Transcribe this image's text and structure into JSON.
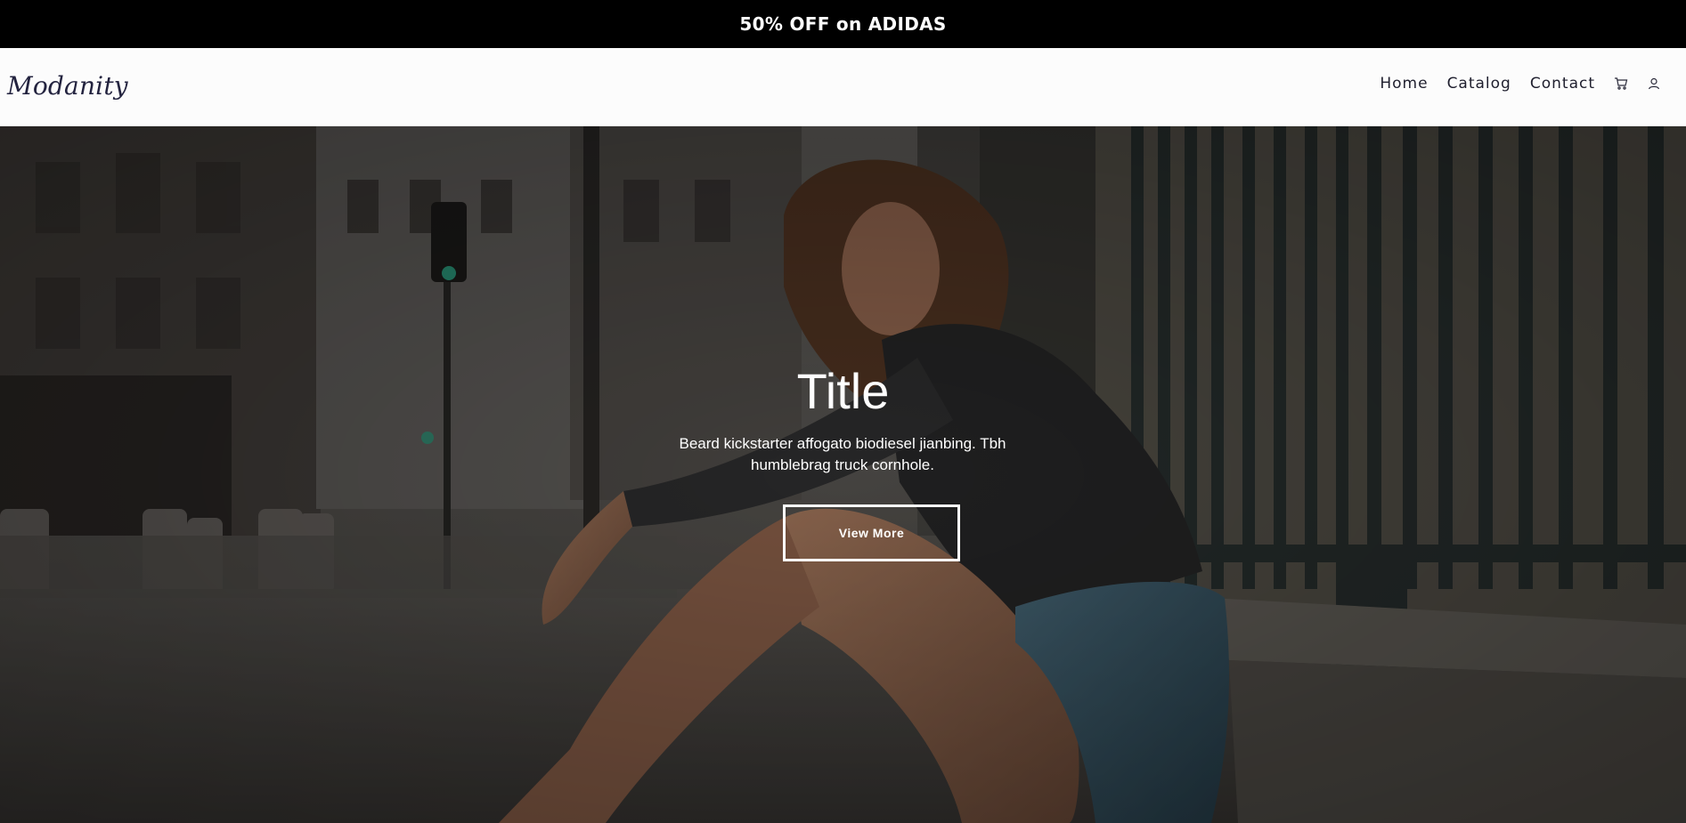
{
  "announcement": {
    "text": "50% OFF on ADIDAS"
  },
  "header": {
    "logo": "Modanity",
    "nav": [
      {
        "label": "Home"
      },
      {
        "label": "Catalog"
      },
      {
        "label": "Contact"
      }
    ],
    "icons": [
      "cart-icon",
      "user-icon"
    ]
  },
  "hero": {
    "title": "Title",
    "text": "Beard kickstarter affogato biodiesel jianbing. Tbh humblebrag truck cornhole.",
    "button_label": "View More",
    "image": "photo-woman-sitting-on-street-curb"
  },
  "colors": {
    "announcement_bg": "#000000",
    "header_bg": "#fcfcfc",
    "logo": "#23233f",
    "hero_text": "#ffffff"
  }
}
